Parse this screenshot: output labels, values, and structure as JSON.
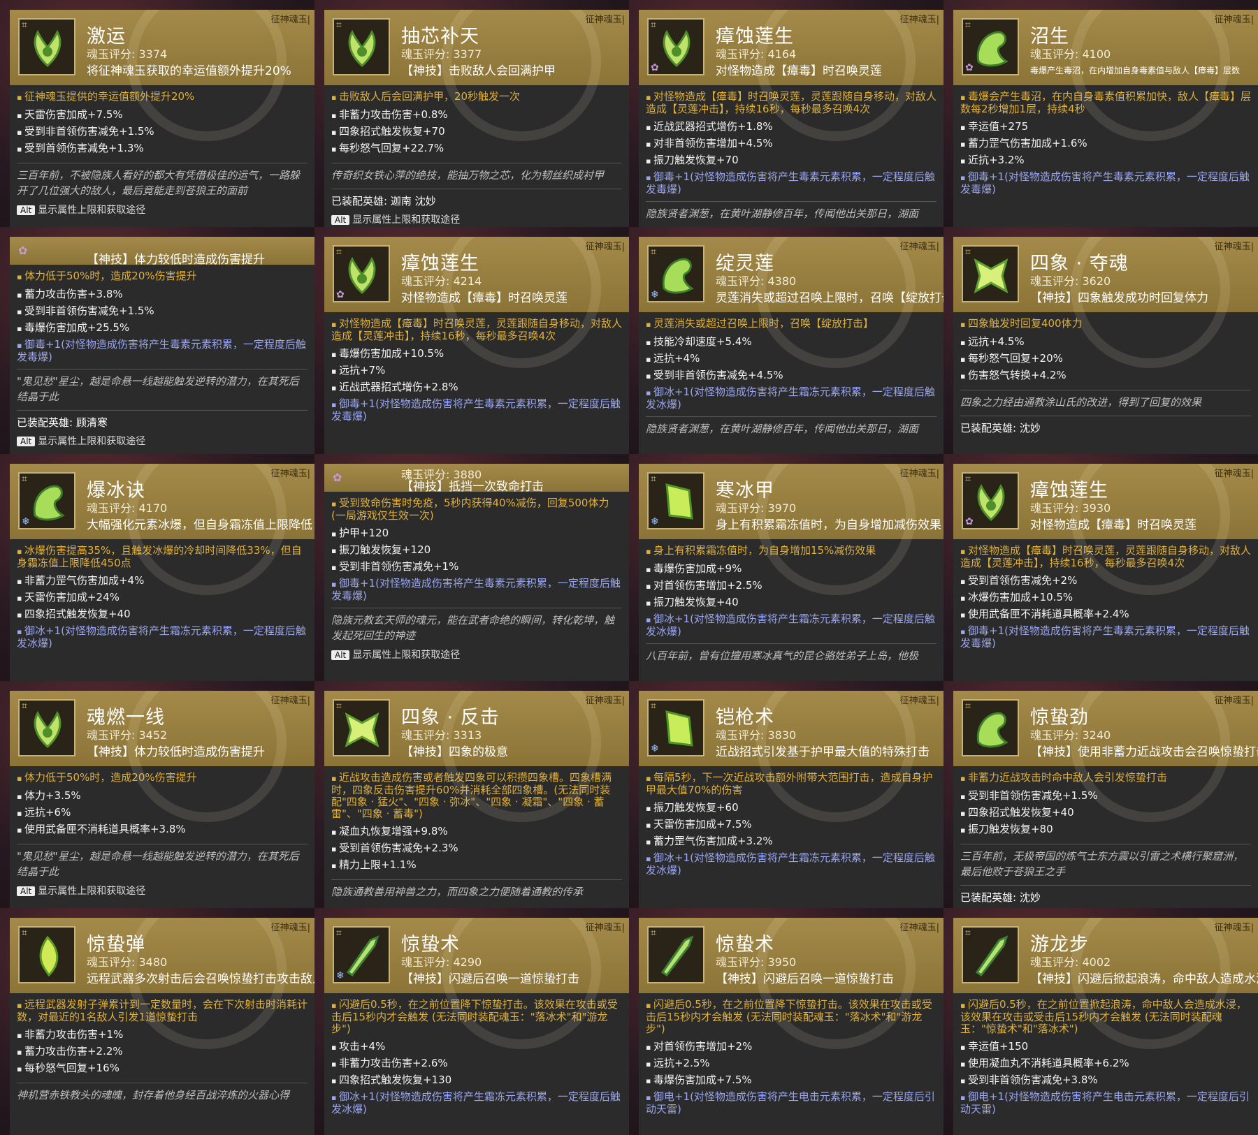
{
  "tag": "征神魂玉|",
  "alt_key": "Alt",
  "alt_text": "显示属性上限和获取途径",
  "cards": [
    {
      "title": "激运",
      "score": "魂玉评分: 3374",
      "desc": "将征神魂玉获取的幸运值额外提升20%",
      "gem": "flower",
      "elem": "",
      "hi": "征神魂玉提供的幸运值额外提升20%",
      "stats": [
        "天雷伤害加成+7.5%",
        "受到非首领伤害减免+1.5%",
        "受到首领伤害减免+1.3%"
      ],
      "blue": "",
      "lore": "三百年前，不被隐族人看好的都大有凭借极佳的运气，一路躲开了几位强大的敌人，最后竟能走到苍狼王的面前",
      "hero": ""
    },
    {
      "title": "抽芯补天",
      "score": "魂玉评分: 3377",
      "desc": "【神技】击败敌人会回满护甲",
      "gem": "flower",
      "elem": "",
      "hi": "击败敌人后会回满护甲，20秒触发一次",
      "stats": [
        "非蓄力攻击伤害+0.8%",
        "四象招式触发恢复+70",
        "每秒怒气回复+22.7%"
      ],
      "blue": "",
      "lore": "传奇织女铁心萍的绝技，能抽万物之芯，化为韧丝织成衬甲",
      "hero": "已装配英雄: 迦南 沈妙"
    },
    {
      "title": "瘴蚀莲生",
      "score": "魂玉评分: 4164",
      "desc": "对怪物造成【瘴毒】时召唤灵莲",
      "gem": "flower",
      "elem": "poison",
      "hi": "对怪物造成【瘴毒】时召唤灵莲，灵莲跟随自身移动，对敌人造成【灵莲冲击】，持续16秒，每秒最多召唤4次",
      "stats": [
        "近战武器招式增伤+1.8%",
        "对非首领伤害增加+4.5%",
        "振刀触发恢复+70"
      ],
      "blue": "御毒+1(对怪物造成伤害将产生毒素元素积累，一定程度后触发毒爆)",
      "lore": "隐族贤者渊葱，在黄叶湖静修百年，传闻他出关那日，湖面",
      "hero": ""
    },
    {
      "title": "沼生",
      "score": "魂玉评分: 4100",
      "desc": "毒爆产生毒沼，在内增加自身毒素值与敌人【瘴毒】层数",
      "gem": "dragon",
      "elem": "poison",
      "small": true,
      "hi": "毒爆会产生毒沼，在内自身毒素值积累加快，敌人【瘴毒】层数每2秒增加1层，持续4秒",
      "stats": [
        "幸运值+275",
        "蓄力罡气伤害加成+1.6%",
        "近抗+3.2%"
      ],
      "blue": "御毒+1(对怪物造成伤害将产生毒素元素积累，一定程度后触发毒爆)",
      "lore": "",
      "hero": ""
    },
    {
      "cut": true,
      "score": "",
      "desc": "【神技】体力较低时造成伤害提升",
      "elem": "poison",
      "hi": "体力低于50%时，造成20%伤害提升",
      "stats": [
        "蓄力攻击伤害+3.8%",
        "受到非首领伤害减免+1.5%",
        "毒爆伤害加成+25.5%"
      ],
      "blue": "御毒+1(对怪物造成伤害将产生毒素元素积累，一定程度后触发毒爆)",
      "lore": "\"鬼见愁\"星尘，越是命悬一线越能触发逆转的潜力，在其死后结晶于此",
      "hero": "已装配英雄: 顾清寒"
    },
    {
      "title": "瘴蚀莲生",
      "score": "魂玉评分: 4214",
      "desc": "对怪物造成【瘴毒】时召唤灵莲",
      "gem": "flower",
      "elem": "poison",
      "hi": "对怪物造成【瘴毒】时召唤灵莲，灵莲跟随自身移动，对敌人造成【灵莲冲击】，持续16秒，每秒最多召唤4次",
      "stats": [
        "毒爆伤害加成+10.5%",
        "远抗+7%",
        "近战武器招式增伤+2.8%"
      ],
      "blue": "御毒+1(对怪物造成伤害将产生毒素元素积累，一定程度后触发毒爆)",
      "lore": "",
      "hero": ""
    },
    {
      "title": "绽灵莲",
      "score": "魂玉评分: 4380",
      "desc": "灵莲消失或超过召唤上限时，召唤【绽放打击】",
      "gem": "dragon",
      "elem": "ice",
      "hi": "灵莲消失或超过召唤上限时，召唤【绽放打击】",
      "stats": [
        "技能冷却速度+5.4%",
        "远抗+4%",
        "受到非首领伤害减免+4.5%"
      ],
      "blue": "御冰+1(对怪物造成伤害将产生霜冻元素积累，一定程度后触发冰爆)",
      "lore": "隐族贤者渊葱，在黄叶湖静修百年，传闻他出关那日，湖面",
      "hero": ""
    },
    {
      "title": "四象 · 夺魂",
      "score": "魂玉评分: 3620",
      "desc": "【神技】四象触发成功时回复体力",
      "gem": "bow",
      "elem": "",
      "hi": "四象触发时回复400体力",
      "stats": [
        "远抗+4.5%",
        "每秒怒气回复+20%",
        "伤害怒气转换+4.2%"
      ],
      "blue": "",
      "lore": "四象之力经由通教涂山氏的改进，得到了回复的效果",
      "hero": "已装配英雄: 沈妙"
    },
    {
      "title": "爆冰诀",
      "score": "魂玉评分: 4170",
      "desc": "大幅强化元素冰爆，但自身霜冻值上限降低",
      "gem": "dragon",
      "elem": "ice",
      "hi": "冰爆伤害提高35%，且触发冰爆的冷却时间降低33%，但自身霜冻值上限降低450点",
      "stats": [
        "非蓄力罡气伤害加成+4%",
        "天雷伤害加成+24%",
        "四象招式触发恢复+40"
      ],
      "blue": "御冰+1(对怪物造成伤害将产生霜冻元素积累，一定程度后触发冰爆)",
      "lore": "",
      "hero": ""
    },
    {
      "cut": true,
      "score": "魂玉评分: 3880",
      "desc": "【神技】抵挡一次致命打击",
      "elem": "poison",
      "hi": "受到致命伤害时免疫，5秒内获得40%减伤，回复500体力(一局游戏仅生效一次)",
      "stats": [
        "护甲+120",
        "振刀触发恢复+120",
        "受到非首领伤害减免+1%"
      ],
      "blue": "御毒+1(对怪物造成伤害将产生毒素元素积累，一定程度后触发毒爆)",
      "lore": "隐族元教玄天师的魂元，能在武者命绝的瞬间，转化乾坤，触发起死回生的神迹",
      "hero": ""
    },
    {
      "title": "寒冰甲",
      "score": "魂玉评分: 3970",
      "desc": "身上有积累霜冻值时，为自身增加减伤效果",
      "gem": "leaf",
      "elem": "ice",
      "hi": "身上有积累霜冻值时，为自身增加15%减伤效果",
      "stats": [
        "毒爆伤害加成+9%",
        "对首领伤害增加+2.5%",
        "振刀触发恢复+40"
      ],
      "blue": "御冰+1(对怪物造成伤害将产生霜冻元素积累，一定程度后触发冰爆)",
      "lore": "八百年前，曾有位擅用寒冰真气的昆仑骆姓弟子上岛，他极",
      "hero": ""
    },
    {
      "title": "瘴蚀莲生",
      "score": "魂玉评分: 3930",
      "desc": "对怪物造成【瘴毒】时召唤灵莲",
      "gem": "flower",
      "elem": "poison",
      "hi": "对怪物造成【瘴毒】时召唤灵莲，灵莲跟随自身移动，对敌人造成【灵莲冲击】，持续16秒，每秒最多召唤4次",
      "stats": [
        "受到首领伤害减免+2%",
        "冰爆伤害加成+10.5%",
        "使用武备匣不消耗道具概率+2.4%"
      ],
      "blue": "御毒+1(对怪物造成伤害将产生毒素元素积累，一定程度后触发毒爆)",
      "lore": "",
      "hero": ""
    },
    {
      "title": "魂燃一线",
      "score": "魂玉评分: 3452",
      "desc": "【神技】体力较低时造成伤害提升",
      "gem": "flower",
      "elem": "",
      "hi": "体力低于50%时，造成20%伤害提升",
      "stats": [
        "体力+3.5%",
        "远抗+6%",
        "使用武备匣不消耗道具概率+3.8%"
      ],
      "blue": "",
      "lore": "\"鬼见愁\"星尘，越是命悬一线越能触发逆转的潜力，在其死后结晶于此",
      "hero": ""
    },
    {
      "title": "四象 · 反击",
      "score": "魂玉评分: 3313",
      "desc": "【神技】四象的极意",
      "gem": "bow",
      "elem": "",
      "hi": "近战攻击造成伤害或者触发四象可以积攒四象槽。四象槽满时，四象反击伤害提升60%并消耗全部四象槽。(无法同时装配\"四象 · 猛火\"、\"四象 · 弥冰\"、\"四象 · 凝霜\"、\"四象 · 蓄雷\"、\"四象 · 蓄毒\")",
      "stats": [
        "凝血丸恢复增强+9.8%",
        "受到首领伤害减免+2.3%",
        "精力上限+1.1%"
      ],
      "blue": "",
      "lore": "隐族通教善用神兽之力，而四象之力便随着通教的传承",
      "hero": ""
    },
    {
      "title": "铠枪术",
      "score": "魂玉评分: 3830",
      "desc": "近战招式引发基于护甲最大值的特殊打击",
      "gem": "leaf",
      "elem": "ice",
      "hi": "每隔5秒，下一次近战攻击额外附带大范围打击，造成自身护甲最大值70%的伤害",
      "stats": [
        "振刀触发恢复+60",
        "天雷伤害加成+7.5%",
        "蓄力罡气伤害加成+3.2%"
      ],
      "blue": "御冰+1(对怪物造成伤害将产生霜冻元素积累，一定程度后触发冰爆)",
      "lore": "",
      "hero": ""
    },
    {
      "title": "惊蛰劲",
      "score": "魂玉评分: 3240",
      "desc": "【神技】使用非蓄力近战攻击会召唤惊蛰打击",
      "gem": "dragon",
      "elem": "",
      "hi": "非蓄力近战攻击时命中敌人会引发惊蛰打击",
      "stats": [
        "受到非首领伤害减免+1.5%",
        "四象招式触发恢复+40",
        "振刀触发恢复+80"
      ],
      "blue": "",
      "lore": "三百年前，无极帝国的炼气士东方震以引雷之术横行聚窟洲，最后他败于苍狼王之手",
      "hero": "已装配英雄: 沈妙"
    },
    {
      "title": "惊蛰弹",
      "score": "魂玉评分: 3480",
      "desc": "远程武器多次射击后会召唤惊蛰打击攻击敌人",
      "gem": "feather",
      "elem": "",
      "hi": "远程武器发射子弹累计到一定数量时，会在下次射击时消耗计数，对最近的1名敌人引发1道惊蛰打击",
      "stats": [
        "非蓄力攻击伤害+1%",
        "蓄力攻击伤害+2.2%",
        "每秒怒气回复+16%"
      ],
      "blue": "",
      "lore": "神机营赤铁教头的魂魄，封存着他身经百战淬炼的火器心得",
      "hero": ""
    },
    {
      "title": "惊蛰术",
      "score": "魂玉评分: 4290",
      "desc": "【神技】闪避后召唤一道惊蛰打击",
      "gem": "sword",
      "elem": "ice",
      "hi": "闪避后0.5秒，在之前位置降下惊蛰打击。该效果在攻击或受击后15秒内才会触发 (无法同时装配魂玉：\"落冰术\"和\"游龙步\")",
      "stats": [
        "攻击+4%",
        "非蓄力攻击伤害+2.6%",
        "四象招式触发恢复+130"
      ],
      "blue": "御冰+1(对怪物造成伤害将产生霜冻元素积累，一定程度后触发冰爆)",
      "lore": "",
      "hero": ""
    },
    {
      "title": "惊蛰术",
      "score": "魂玉评分: 3950",
      "desc": "【神技】闪避后召唤一道惊蛰打击",
      "gem": "sword",
      "elem": "",
      "hi": "闪避后0.5秒，在之前位置降下惊蛰打击。该效果在攻击或受击后15秒内才会触发 (无法同时装配魂玉：\"落冰术\"和\"游龙步\")",
      "stats": [
        "对首领伤害增加+2%",
        "远抗+2.5%",
        "毒爆伤害加成+7.5%"
      ],
      "blue": "御电+1(对怪物造成伤害将产生电击元素积累，一定程度后引动天雷)",
      "lore": "",
      "hero": ""
    },
    {
      "title": "游龙步",
      "score": "魂玉评分: 4002",
      "desc": "【神技】闪避后掀起浪涛，命中敌人造成水浸",
      "gem": "sword",
      "elem": "",
      "hi": "闪避后0.5秒，在之前位置掀起浪涛，命中敌人会造成水浸，该效果在攻击或受击后15秒内才会触发 (无法同时装配魂玉：\"惊蛰术\"和\"落冰术\")",
      "stats": [
        "幸运值+150",
        "使用凝血丸不消耗道具概率+6.2%",
        "受到非首领伤害减免+3.8%"
      ],
      "blue": "御电+1(对怪物造成伤害将产生电击元素积累，一定程度后引动天雷)",
      "lore": "",
      "hero": ""
    }
  ]
}
